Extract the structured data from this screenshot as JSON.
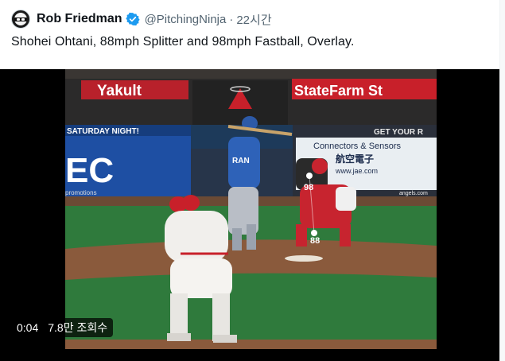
{
  "tweet": {
    "author_name": "Rob Friedman",
    "handle": "@PitchingNinja",
    "separator": "·",
    "timestamp": "22시간",
    "text": "Shohei Ohtani, 88mph Splitter and 98mph Fastball, Overlay.",
    "verified_color": "#1d9bf0"
  },
  "video": {
    "elapsed": "0:04",
    "views": "7.8만 조회수",
    "scene": {
      "banner_left": "Yakult",
      "banner_right": "StateFarm  St",
      "board_left_header": "SATURDAY NIGHT!",
      "board_left_logo": "EC",
      "board_left_foot": "promotions",
      "board_right_header": "GET YOUR R",
      "board_right_line1": "Connectors & Sensors",
      "board_right_line2": "航空電子",
      "board_right_line3": "www.jae.com",
      "board_right_foot": "angels.com",
      "pitch_fastball": "98",
      "pitch_splitter": "88"
    }
  }
}
